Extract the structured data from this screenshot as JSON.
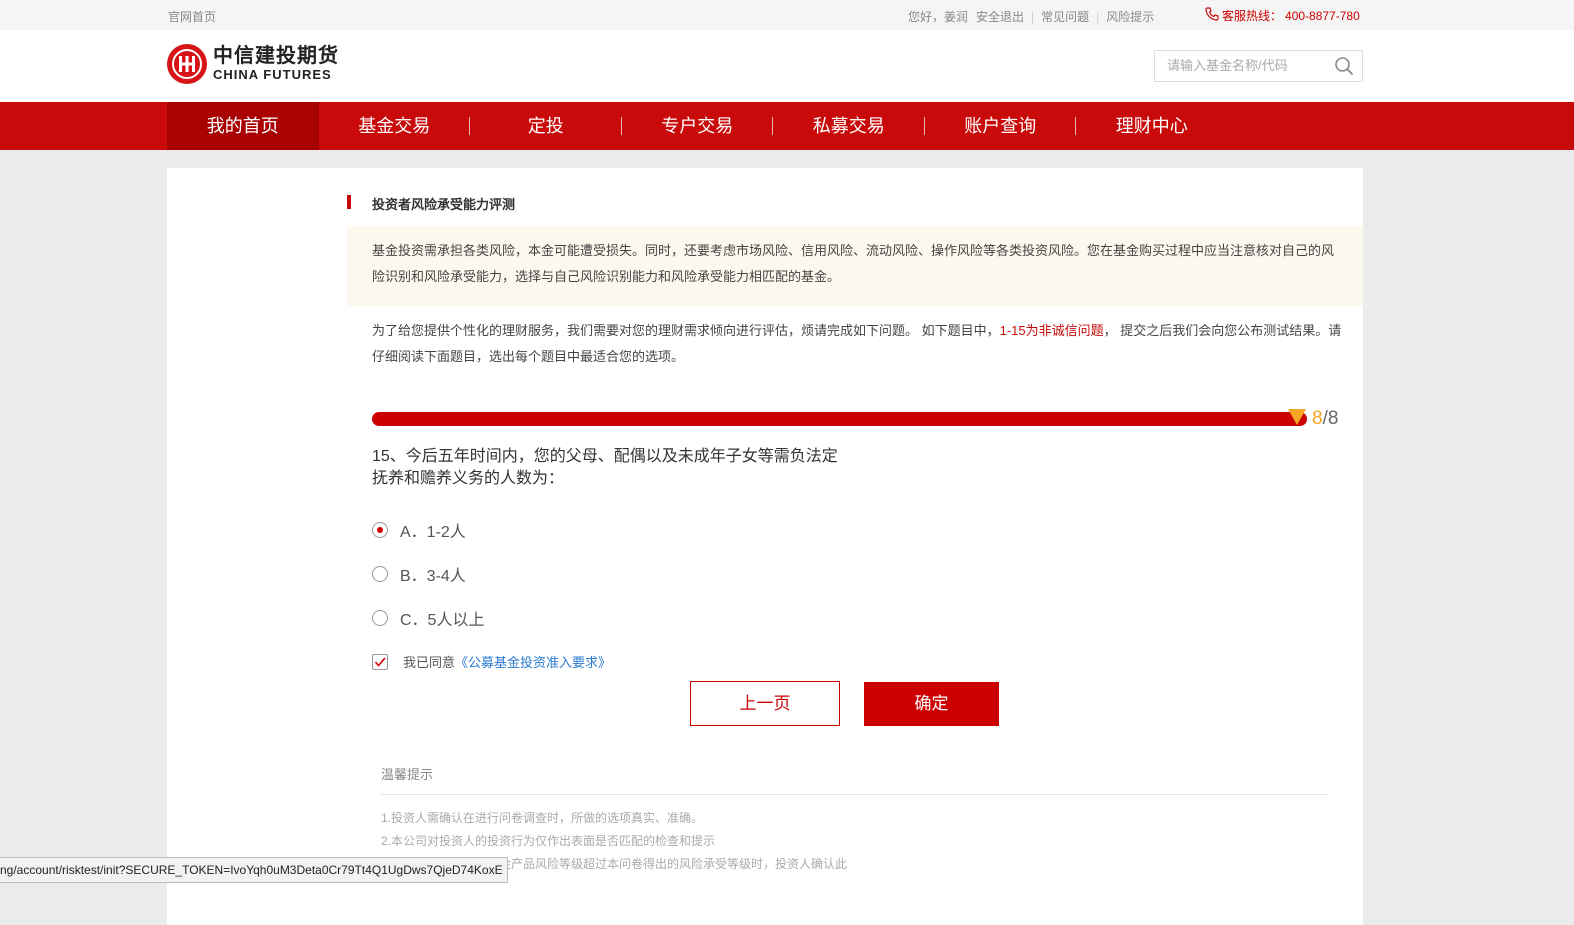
{
  "topbar": {
    "home_link": "官网首页",
    "greeting": "您好，姜润",
    "logout": "安全退出",
    "faq": "常见问题",
    "risk_tip": "风险提示",
    "hotline_label": "客服热线：",
    "hotline_number": "400-8877-780"
  },
  "header": {
    "logo_cn": "中信建投期货",
    "logo_en": "CHINA FUTURES",
    "search_placeholder": "请输入基金名称/代码"
  },
  "nav": {
    "items": [
      {
        "label": "我的首页",
        "active": true
      },
      {
        "label": "基金交易",
        "active": false
      },
      {
        "label": "定投",
        "active": false
      },
      {
        "label": "专户交易",
        "active": false
      },
      {
        "label": "私募交易",
        "active": false
      },
      {
        "label": "账户查询",
        "active": false
      },
      {
        "label": "理财中心",
        "active": false
      }
    ]
  },
  "section_title": "投资者风险承受能力评测",
  "notice": "基金投资需承担各类风险，本金可能遭受损失。同时，还要考虑市场风险、信用风险、流动风险、操作风险等各类投资风险。您在基金购买过程中应当注意核对自己的风险识别和风险承受能力，选择与自己风险识别能力和风险承受能力相匹配的基金。",
  "intro": {
    "part1": "为了给您提供个性化的理财服务，我们需要对您的理财需求倾向进行评估，烦请完成如下问题。 如下题目中，",
    "highlight": "1-15为非诚信问题",
    "part2": "， 提交之后我们会向您公布测试结果。请仔细阅读下面题目，选出每个题目中最适合您的选项。"
  },
  "progress": {
    "current": "8",
    "total": "/8",
    "fraction": 1.0
  },
  "question": {
    "text": "15、今后五年时间内，您的父母、配偶以及未成年子女等需负法定抚养和赡养义务的人数为：",
    "options": [
      {
        "label": "A．1-2人",
        "selected": true
      },
      {
        "label": "B．3-4人",
        "selected": false
      },
      {
        "label": "C．5人以上",
        "selected": false
      }
    ]
  },
  "agreement": {
    "checked": true,
    "prefix": "我已同意",
    "link": "《公募基金投资准入要求》"
  },
  "buttons": {
    "prev": "上一页",
    "confirm": "确定"
  },
  "tips": {
    "title": "温馨提示",
    "items": [
      "1.投资人需确认在进行问卷调查时，所做的选项真实、准确。",
      "2.本公司对投资人的投资行为仅作出表面是否匹配的检查和提示",
      "3.如投资人所选择的基金产品风险等级超过本问卷得出的风险承受等级时，投资人确认此"
    ]
  },
  "status_url": "ng/account/risktest/init?SECURE_TOKEN=IvoYqh0uM3Deta0Cr79Tt4Q1UgDws7QjeD74KoxE",
  "colors": {
    "brand_red": "#c80a0a",
    "nav_active": "#a80202",
    "link_blue": "#2a7ad2",
    "progress_orange": "#f5a623"
  }
}
